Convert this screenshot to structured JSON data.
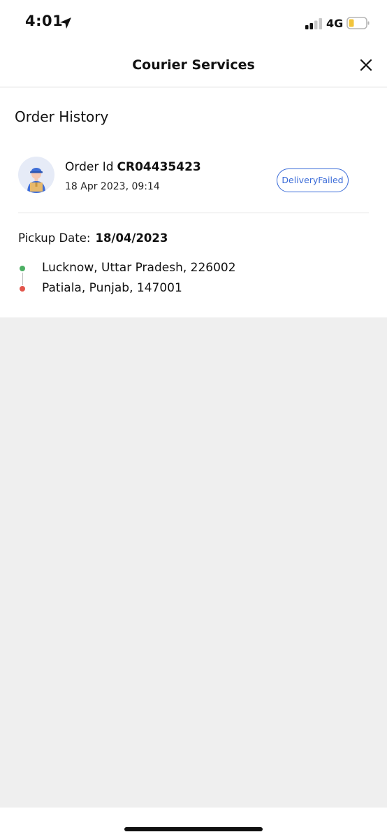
{
  "status_bar": {
    "time": "4:01",
    "network": "4G",
    "icons": [
      "location-arrow-icon",
      "signal-bars-icon",
      "battery-icon"
    ],
    "battery_color": "#f2c43b"
  },
  "header": {
    "title": "Courier Services",
    "close_icon": "close-icon"
  },
  "order_history": {
    "title": "Order History",
    "order": {
      "id_label": "Order Id",
      "id_value": "CR04435423",
      "datetime": "18 Apr 2023, 09:14",
      "status": "DeliveryFailed",
      "status_color": "#3a6bd8",
      "avatar_icon": "courier-avatar-icon"
    },
    "pickup": {
      "label": "Pickup Date:",
      "value": "18/04/2023"
    },
    "route": {
      "from": "Lucknow, Uttar Pradesh, 226002",
      "to": "Patiala, Punjab, 147001",
      "from_color": "#4caf63",
      "to_color": "#e2554b"
    }
  }
}
